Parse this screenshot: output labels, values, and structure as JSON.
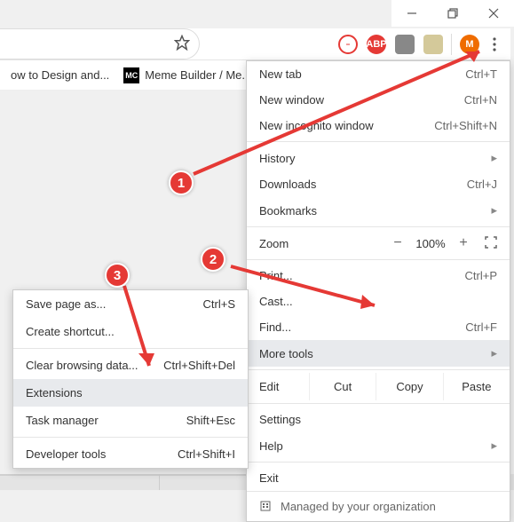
{
  "window_controls": {
    "minimize": "—",
    "maximize": "❐",
    "close": "✕"
  },
  "toolbar": {
    "extensions": [
      {
        "bg": "#ffffff",
        "text": "",
        "label": "block-icon",
        "ring": "#e53935"
      },
      {
        "bg": "#e53935",
        "text": "ABP",
        "label": "adblock-plus-icon"
      },
      {
        "bg": "#777",
        "text": "",
        "label": "ext-icon-3"
      },
      {
        "bg": "#ddd",
        "text": "",
        "label": "ext-icon-4"
      }
    ],
    "profile": {
      "bg": "#ef6c00",
      "text": "M"
    }
  },
  "bookmarks": [
    {
      "label": "ow to Design and...",
      "has_fav": false
    },
    {
      "label": "Meme Builder / Me...",
      "has_fav": true,
      "fav_text": "MC"
    }
  ],
  "menu": {
    "new_tab": {
      "label": "New tab",
      "shortcut": "Ctrl+T"
    },
    "new_window": {
      "label": "New window",
      "shortcut": "Ctrl+N"
    },
    "new_incognito": {
      "label": "New incognito window",
      "shortcut": "Ctrl+Shift+N"
    },
    "history": {
      "label": "History"
    },
    "downloads": {
      "label": "Downloads",
      "shortcut": "Ctrl+J"
    },
    "bookmarks": {
      "label": "Bookmarks"
    },
    "zoom": {
      "label": "Zoom",
      "minus": "−",
      "value": "100%",
      "plus": "+"
    },
    "print": {
      "label": "Print...",
      "shortcut": "Ctrl+P"
    },
    "cast": {
      "label": "Cast..."
    },
    "find": {
      "label": "Find...",
      "shortcut": "Ctrl+F"
    },
    "more_tools": {
      "label": "More tools"
    },
    "edit": {
      "label": "Edit",
      "cut": "Cut",
      "copy": "Copy",
      "paste": "Paste"
    },
    "settings": {
      "label": "Settings"
    },
    "help": {
      "label": "Help"
    },
    "exit": {
      "label": "Exit"
    },
    "managed": {
      "label": "Managed by your organization"
    }
  },
  "submenu": {
    "save_page": {
      "label": "Save page as...",
      "shortcut": "Ctrl+S"
    },
    "create_shortcut": {
      "label": "Create shortcut..."
    },
    "clear_data": {
      "label": "Clear browsing data...",
      "shortcut": "Ctrl+Shift+Del"
    },
    "extensions": {
      "label": "Extensions"
    },
    "task_manager": {
      "label": "Task manager",
      "shortcut": "Shift+Esc"
    },
    "dev_tools": {
      "label": "Developer tools",
      "shortcut": "Ctrl+Shift+I"
    }
  },
  "annotations": {
    "one": "1",
    "two": "2",
    "three": "3"
  }
}
